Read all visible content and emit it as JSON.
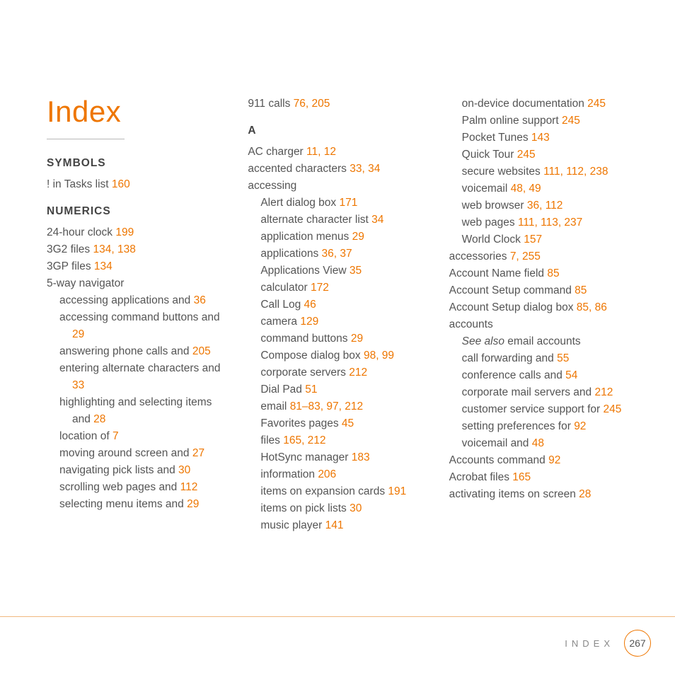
{
  "title": "Index",
  "footer": {
    "label": "INDEX",
    "page": "267"
  },
  "col1": {
    "headSymbols": "SYMBOLS",
    "e_tasks": {
      "t": "! in Tasks list ",
      "p": "160"
    },
    "headNumerics": "NUMERICS",
    "e_24h": {
      "t": "24-hour clock ",
      "p": "199"
    },
    "e_3g2": {
      "t": "3G2 files ",
      "p": "134, 138"
    },
    "e_3gp": {
      "t": "3GP files ",
      "p": "134"
    },
    "e_5way": {
      "t": "5-way navigator"
    },
    "s_accapp": {
      "t": "accessing applications and ",
      "p": "36"
    },
    "s_acccmd": {
      "t": "accessing command buttons and ",
      "p": "29"
    },
    "s_ansphone": {
      "t": "answering phone calls and ",
      "p": "205"
    },
    "s_entalt": {
      "t": "entering alternate characters and ",
      "p": "33"
    },
    "s_highsel": {
      "t": "highlighting and selecting items and ",
      "p": "28"
    },
    "s_loc": {
      "t": "location of ",
      "p": "7"
    },
    "s_move": {
      "t": "moving around screen and ",
      "p": "27"
    },
    "s_navpick": {
      "t": "navigating pick lists and ",
      "p": "30"
    },
    "s_scroll": {
      "t": "scrolling web pages and ",
      "p": "112"
    },
    "s_selmenu": {
      "t": "selecting menu items and ",
      "p": "29"
    }
  },
  "col2": {
    "e_911": {
      "t": "911 calls ",
      "p": "76, 205"
    },
    "headA": "A",
    "e_ac": {
      "t": "AC charger ",
      "p": "11, 12"
    },
    "e_accchar": {
      "t": "accented characters ",
      "p": "33, 34"
    },
    "e_accessing": {
      "t": "accessing"
    },
    "s_alert": {
      "t": "Alert dialog box ",
      "p": "171"
    },
    "s_altchar": {
      "t": "alternate character list ",
      "p": "34"
    },
    "s_appmenu": {
      "t": "application menus ",
      "p": "29"
    },
    "s_apps": {
      "t": "applications ",
      "p": "36, 37"
    },
    "s_appsview": {
      "t": "Applications View ",
      "p": "35"
    },
    "s_calc": {
      "t": "calculator ",
      "p": "172"
    },
    "s_calllog": {
      "t": "Call Log ",
      "p": "46"
    },
    "s_camera": {
      "t": "camera ",
      "p": "129"
    },
    "s_cmdbtn": {
      "t": "command buttons ",
      "p": "29"
    },
    "s_compose": {
      "t": "Compose dialog box ",
      "p": "98, 99"
    },
    "s_corpserv": {
      "t": "corporate servers ",
      "p": "212"
    },
    "s_dialpad": {
      "t": "Dial Pad ",
      "p": "51"
    },
    "s_email": {
      "t": "email ",
      "p": "81–83, 97, 212"
    },
    "s_fav": {
      "t": "Favorites pages ",
      "p": "45"
    },
    "s_files": {
      "t": "files ",
      "p": "165, 212"
    },
    "s_hotsync": {
      "t": "HotSync manager ",
      "p": "183"
    },
    "s_info": {
      "t": "information ",
      "p": "206"
    },
    "s_expcards": {
      "t": "items on expansion cards ",
      "p": "191"
    },
    "s_picklists": {
      "t": "items on pick lists ",
      "p": "30"
    },
    "s_music": {
      "t": "music player ",
      "p": "141"
    }
  },
  "col3": {
    "s_ondevice": {
      "t": "on-device documentation ",
      "p": "245"
    },
    "s_palmsupport": {
      "t": "Palm online support ",
      "p": "245"
    },
    "s_pocket": {
      "t": "Pocket Tunes ",
      "p": "143"
    },
    "s_quick": {
      "t": "Quick Tour ",
      "p": "245"
    },
    "s_secure": {
      "t": "secure websites ",
      "p": "111, 112, 238"
    },
    "s_voicemail": {
      "t": "voicemail ",
      "p": "48, 49"
    },
    "s_webbrowser": {
      "t": "web browser ",
      "p": "36, 112"
    },
    "s_webpages": {
      "t": "web pages ",
      "p": "111, 113, 237"
    },
    "s_worldclock": {
      "t": "World Clock ",
      "p": "157"
    },
    "e_accessories": {
      "t": "accessories ",
      "p": "7, 255"
    },
    "e_acctname": {
      "t": "Account Name field ",
      "p": "85"
    },
    "e_acctsetupcmd": {
      "t": "Account Setup command ",
      "p": "85"
    },
    "e_acctsetupdlg": {
      "t": "Account Setup dialog box ",
      "p": "85, 86"
    },
    "e_accounts": {
      "t": "accounts"
    },
    "s_seealso_pre": "See also",
    "s_seealso": {
      "t": " email accounts"
    },
    "s_callfwd": {
      "t": "call forwarding and ",
      "p": "55"
    },
    "s_confcalls": {
      "t": "conference calls and ",
      "p": "54"
    },
    "s_corpmail": {
      "t": "corporate mail servers and ",
      "p": "212"
    },
    "s_custsvc": {
      "t": "customer service support for ",
      "p": "245"
    },
    "s_setpref": {
      "t": "setting preferences for ",
      "p": "92"
    },
    "s_vmand": {
      "t": "voicemail and ",
      "p": "48"
    },
    "e_accountscmd": {
      "t": "Accounts command ",
      "p": "92"
    },
    "e_acrobat": {
      "t": "Acrobat files ",
      "p": "165"
    },
    "e_activating": {
      "t": "activating items on screen ",
      "p": "28"
    }
  }
}
